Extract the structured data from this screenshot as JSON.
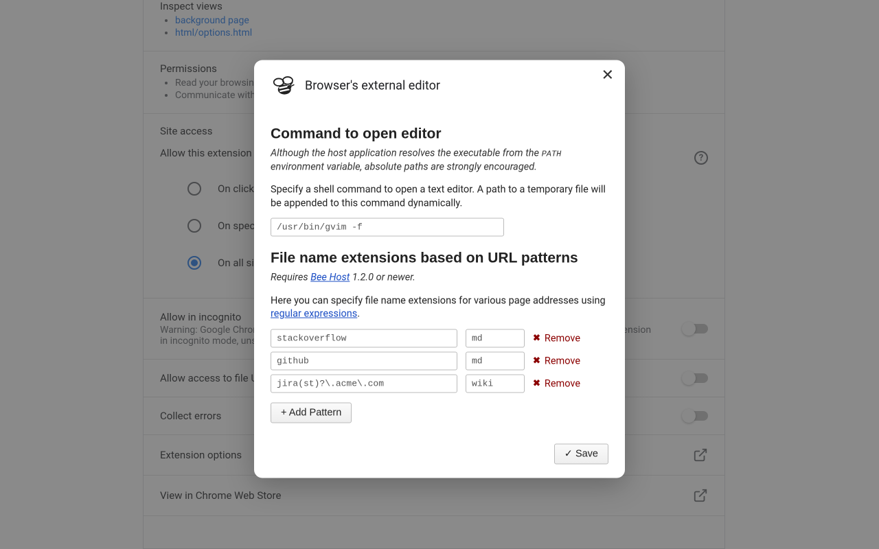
{
  "background": {
    "inspect": {
      "heading": "Inspect views",
      "items": [
        "background page",
        "html/options.html"
      ]
    },
    "permissions": {
      "heading": "Permissions",
      "items": [
        "Read your browsing history",
        "Communicate with cooperating native applications"
      ]
    },
    "site_access": {
      "heading": "Site access",
      "allow_label": "Allow this extension to read and change all your data on websites you visit:",
      "options": [
        "On click",
        "On specific sites",
        "On all sites"
      ],
      "help_tooltip": "?"
    },
    "incognito": {
      "label": "Allow in incognito",
      "sub": "Warning: Google Chrome cannot prevent extensions from recording your browsing history. To disable this extension in incognito mode, unselect this option."
    },
    "file_urls": {
      "label": "Allow access to file URLs"
    },
    "collect_errors": {
      "label": "Collect errors"
    },
    "extension_options": {
      "label": "Extension options"
    },
    "web_store": {
      "label": "View in Chrome Web Store"
    }
  },
  "modal": {
    "title": "Browser's external editor",
    "section1_heading": "Command to open editor",
    "section1_sub_a": "Although the host application resolves the executable from the ",
    "section1_sub_path": "PATH",
    "section1_sub_b": " environment variable, absolute paths are strongly encouraged.",
    "section1_body": "Specify a shell command to open a text editor. A path to a temporary file will be appended to this command dynamically.",
    "command_value": "/usr/bin/gvim -f",
    "section2_heading": "File name extensions based on URL patterns",
    "section2_sub_a": "Requires ",
    "section2_sub_link": "Bee Host",
    "section2_sub_b": " 1.2.0 or newer.",
    "section2_body_a": "Here you can specify file name extensions for various page addresses using ",
    "section2_body_link": "regular expressions",
    "section2_body_b": ".",
    "patterns": [
      {
        "url": "stackoverflow",
        "ext": "md"
      },
      {
        "url": "github",
        "ext": "md"
      },
      {
        "url": "jira(st)?\\.acme\\.com",
        "ext": "wiki"
      }
    ],
    "remove_label": "Remove",
    "add_pattern_label": "+ Add Pattern",
    "save_label": "✓ Save"
  }
}
